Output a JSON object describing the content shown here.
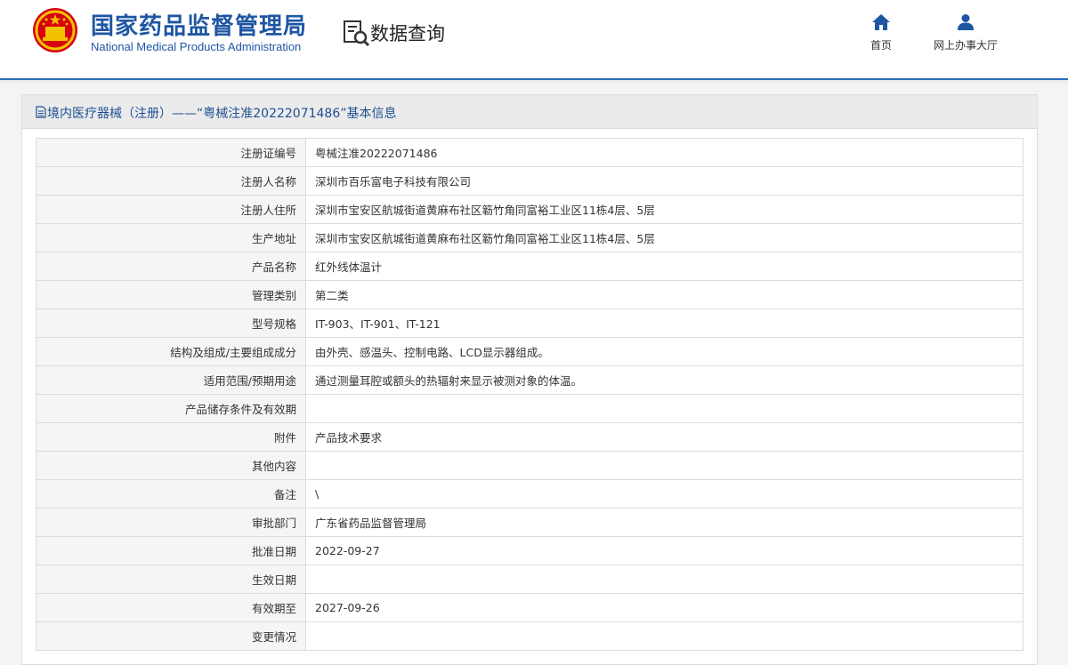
{
  "header": {
    "title": "国家药品监督管理局",
    "subtitle": "National Medical Products Administration",
    "query_label": "数据查询",
    "nav": [
      {
        "label": "首页",
        "icon": "home-icon"
      },
      {
        "label": "网上办事大厅",
        "icon": "user-icon"
      }
    ]
  },
  "colors": {
    "brand_blue": "#1e56a3",
    "header_rule": "#2a6db8",
    "emblem_red": "#d7000f",
    "emblem_gold": "#f2c200"
  },
  "panel": {
    "title": "境内医疗器械（注册）——“粤械注准20222071486”基本信息",
    "rows": [
      {
        "label": "注册证编号",
        "value": "粤械注准20222071486"
      },
      {
        "label": "注册人名称",
        "value": "深圳市百乐富电子科技有限公司"
      },
      {
        "label": "注册人住所",
        "value": "深圳市宝安区航城街道黄麻布社区簕竹角同富裕工业区11栋4层、5层"
      },
      {
        "label": "生产地址",
        "value": "深圳市宝安区航城街道黄麻布社区簕竹角同富裕工业区11栋4层、5层"
      },
      {
        "label": "产品名称",
        "value": "红外线体温计"
      },
      {
        "label": "管理类别",
        "value": "第二类"
      },
      {
        "label": "型号规格",
        "value": "IT-903、IT-901、IT-121"
      },
      {
        "label": "结构及组成/主要组成成分",
        "value": "由外壳、感温头、控制电路、LCD显示器组成。"
      },
      {
        "label": "适用范围/预期用途",
        "value": "通过测量耳腔或额头的热辐射来显示被测对象的体温。"
      },
      {
        "label": "产品储存条件及有效期",
        "value": ""
      },
      {
        "label": "附件",
        "value": "产品技术要求"
      },
      {
        "label": "其他内容",
        "value": ""
      },
      {
        "label": "备注",
        "value": "\\"
      },
      {
        "label": "审批部门",
        "value": "广东省药品监督管理局"
      },
      {
        "label": "批准日期",
        "value": "2022-09-27"
      },
      {
        "label": "生效日期",
        "value": ""
      },
      {
        "label": "有效期至",
        "value": "2027-09-26"
      },
      {
        "label": "变更情况",
        "value": ""
      }
    ]
  }
}
